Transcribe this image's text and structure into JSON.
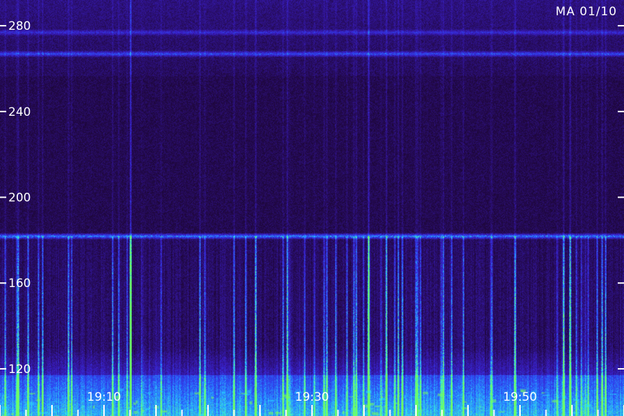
{
  "stamp": "MA 01/10",
  "chart_data": {
    "type": "heatmap",
    "title": "",
    "xlabel": "",
    "ylabel": "",
    "y_ticks": [
      "280",
      "240",
      "200",
      "160",
      "120"
    ],
    "y_tick_values": [
      280,
      240,
      200,
      160,
      120
    ],
    "ylim": [
      98,
      292
    ],
    "x_tick_labels": [
      "19:10",
      "19:30",
      "19:50"
    ],
    "x_tick_values": [
      10,
      30,
      50
    ],
    "xlim": [
      0,
      60
    ],
    "colors": {
      "background": "#1a0a33",
      "low": "#2a0d55",
      "mid": "#3a28d8",
      "high": "#2ee6ff",
      "peak": "#7dff5a"
    },
    "bands": [
      {
        "y": 182,
        "intensity": "strong"
      },
      {
        "y": 267,
        "intensity": "medium"
      },
      {
        "y": 277,
        "intensity": "weak"
      }
    ],
    "lower_activity_band": [
      100,
      130
    ]
  }
}
